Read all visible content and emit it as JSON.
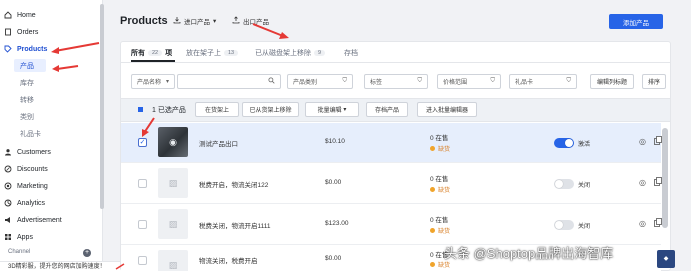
{
  "sidebar": {
    "items": [
      {
        "label": "Home",
        "icon": "home-icon"
      },
      {
        "label": "Orders",
        "icon": "orders-icon"
      },
      {
        "label": "Products",
        "icon": "tag-icon"
      },
      {
        "label": "Customers",
        "icon": "person-icon"
      },
      {
        "label": "Discounts",
        "icon": "discount-icon"
      },
      {
        "label": "Marketing",
        "icon": "target-icon"
      },
      {
        "label": "Analytics",
        "icon": "analytics-icon"
      },
      {
        "label": "Advertisement",
        "icon": "advertisement-icon"
      },
      {
        "label": "Apps",
        "icon": "apps-icon"
      }
    ],
    "product_subitems": [
      "产品",
      "库存",
      "转移",
      "类别",
      "礼品卡"
    ],
    "channel_label": "Channel",
    "bottom_banner": "3D精彩服，提升您的网店加购速度！"
  },
  "header": {
    "title": "Products",
    "import_label": "进口产品",
    "export_label": "出口产品",
    "add_button": "添加产品"
  },
  "tabs": [
    {
      "label": "所有",
      "count": "22",
      "suffix": "项"
    },
    {
      "label": "放在架子上",
      "count": "13"
    },
    {
      "label": "已从磁盘架上移除",
      "count": "9"
    },
    {
      "label": "存档"
    }
  ],
  "filters": {
    "name_select": "产品名称",
    "category": "产品类别",
    "tags": "标签",
    "price_range": "价格范围",
    "gift_card": "礼品卡",
    "edit_columns": "编辑列标题",
    "sort": "排序"
  },
  "bulk_actions": {
    "selected_text": "1 已选产品",
    "put_on_shelf": "在货架上",
    "remove_from_shelf": "已从货架上移除",
    "bulk_edit": "批量编辑",
    "archive": "存档产品",
    "open_editor": "进入批量编辑器"
  },
  "products": [
    {
      "name": "测试产品出口",
      "price": "$10.10",
      "stock": "0 在售",
      "status": "缺货",
      "active": true,
      "toggle_label": "激活",
      "selected": true
    },
    {
      "name": "税费开启，物流关闭122",
      "price": "$0.00",
      "stock": "0 在售",
      "status": "缺货",
      "active": false,
      "toggle_label": "关闭",
      "selected": false
    },
    {
      "name": "税费关闭，物流开启1111",
      "price": "$123.00",
      "stock": "0 在售",
      "status": "缺货",
      "active": false,
      "toggle_label": "关闭",
      "selected": false
    },
    {
      "name": "物流关闭，税费开启",
      "price": "$0.00",
      "stock": "0 在售",
      "status": "缺货",
      "active": false,
      "toggle_label": "关闭",
      "selected": false
    }
  ],
  "watermark": "头条 @Shoptop品牌出海智库",
  "colors": {
    "accent": "#2764e7",
    "annotation": "#e53935",
    "warning": "#d9822b"
  }
}
